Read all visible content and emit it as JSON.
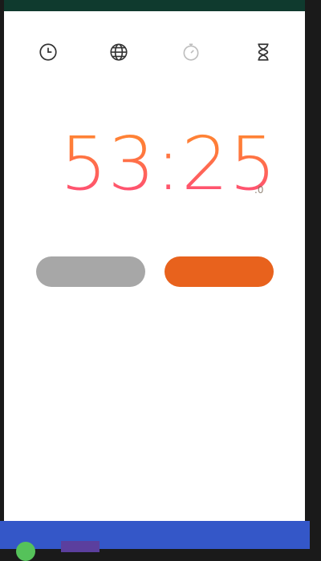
{
  "status_bar": {
    "left_text": "",
    "right_text": ""
  },
  "tabs": [
    {
      "id": "alarm",
      "icon": "clock-icon"
    },
    {
      "id": "world",
      "icon": "globe-icon"
    },
    {
      "id": "stopwatch",
      "icon": "stopwatch-icon"
    },
    {
      "id": "timer",
      "icon": "hourglass-icon"
    }
  ],
  "timer": {
    "time": "53:25",
    "sub": ".0"
  },
  "buttons": {
    "left_label": "",
    "right_label": ""
  },
  "colors": {
    "accent": "#e8621d",
    "digit_gradient_top": "#ff8a30",
    "digit_gradient_bottom": "#ff3f8a",
    "taskbar": "#3457c8"
  }
}
